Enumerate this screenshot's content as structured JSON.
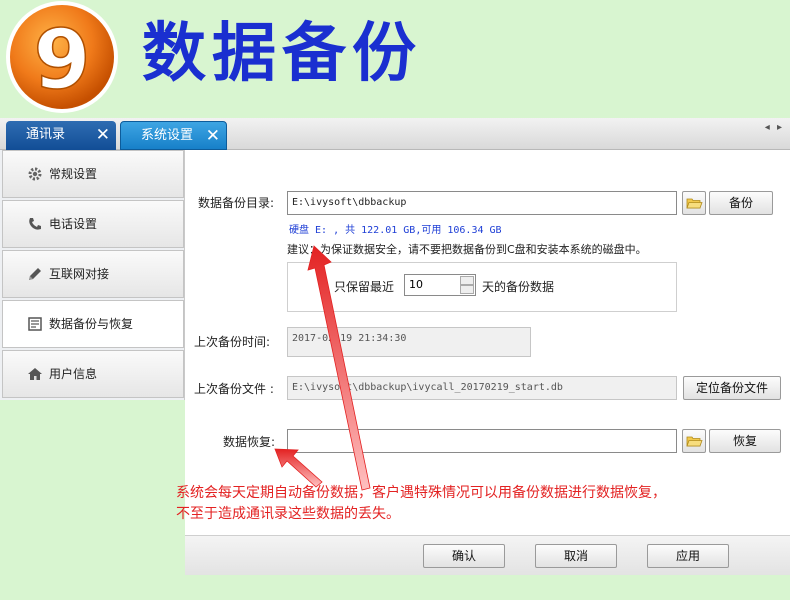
{
  "banner": {
    "step_number": "9",
    "title": "数据备份"
  },
  "tabs": [
    {
      "label": "通讯录",
      "close": "✕"
    },
    {
      "label": "系统设置",
      "close": "✕"
    }
  ],
  "tab_scroll": "◂ ▸",
  "sidebar": {
    "items": [
      {
        "label": "常规设置",
        "icon": "gear-icon"
      },
      {
        "label": "电话设置",
        "icon": "phone-icon"
      },
      {
        "label": "互联网对接",
        "icon": "pencil-icon"
      },
      {
        "label": "数据备份与恢复",
        "icon": "document-icon"
      },
      {
        "label": "用户信息",
        "icon": "home-icon"
      }
    ]
  },
  "backup": {
    "dir_label": "数据备份目录:",
    "dir_value": "E:\\ivysoft\\dbbackup",
    "backup_button": "备份",
    "disk_info": "硬盘 E: , 共 122.01 GB,可用 106.34 GB",
    "advice": "建议：为保证数据安全，请不要把数据备份到C盘和安装本系统的磁盘中。",
    "keep_prefix": "只保留最近",
    "keep_value": "10",
    "keep_suffix": "天的备份数据",
    "last_time_label": "上次备份时间:",
    "last_time_value": "2017-02-19 21:34:30",
    "last_file_label": "上次备份文件 :",
    "last_file_value": "E:\\ivysoft\\dbbackup\\ivycall_20170219_start.db",
    "locate_button": "定位备份文件"
  },
  "restore": {
    "label": "数据恢复:",
    "value": "",
    "button": "恢复"
  },
  "footer": {
    "ok": "确认",
    "cancel": "取消",
    "apply": "应用"
  },
  "annotation": {
    "line1": "系统会每天定期自动备份数据，客户遇特殊情况可以用备份数据进行数据恢复，",
    "line2": "不至于造成通讯录这些数据的丢失。"
  },
  "colors": {
    "banner_title": "#1a2fd0",
    "badge": "#f07a1a",
    "tab_active": "#1780c9",
    "annotation": "#e32222",
    "page_bg": "#d8f5d0"
  }
}
